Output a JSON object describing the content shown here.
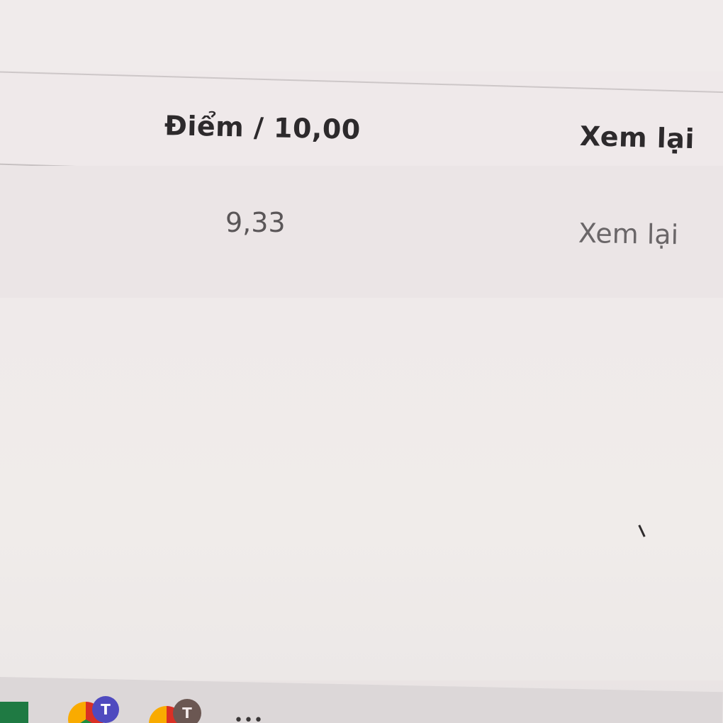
{
  "table": {
    "headers": {
      "score": "Điểm / 10,00",
      "review": "Xem lại"
    },
    "rows": [
      {
        "score": "9,33",
        "review": "Xem lại"
      }
    ]
  },
  "taskbar": {
    "apps": [
      {
        "icon": "excel-icon"
      },
      {
        "icon": "chrome-icon",
        "badge": "T",
        "badge_color": "#4f4abf"
      },
      {
        "icon": "chrome-icon",
        "badge": "T",
        "badge_color": "#6b5752"
      },
      {
        "icon": "more-apps-icon"
      }
    ]
  },
  "colors": {
    "background": "#efe9ea",
    "header_text": "#2d2a2c",
    "body_text": "#5a5658",
    "row_divider": "#c6c0c1"
  }
}
